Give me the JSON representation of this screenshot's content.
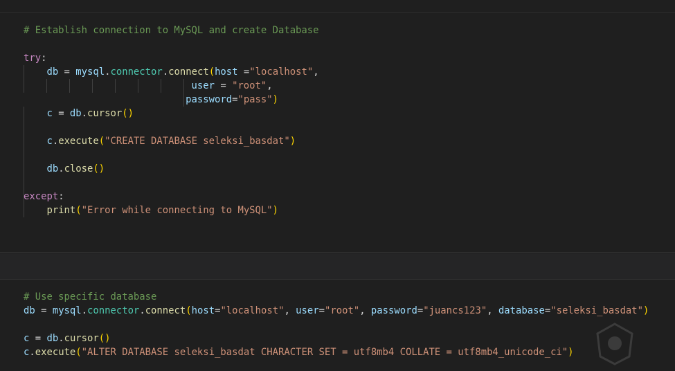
{
  "cell1": {
    "lines": [
      {
        "tokens": [
          {
            "t": "# Establish connection to MySQL and create Database",
            "c": "cm"
          }
        ]
      },
      {
        "tokens": []
      },
      {
        "tokens": [
          {
            "t": "try",
            "c": "kw"
          },
          {
            "t": ":",
            "c": "pn"
          }
        ]
      },
      {
        "tokens": [
          {
            "t": "    ",
            "c": "pn"
          },
          {
            "t": "db",
            "c": "vr"
          },
          {
            "t": " = ",
            "c": "op"
          },
          {
            "t": "mysql",
            "c": "vr"
          },
          {
            "t": ".",
            "c": "pn"
          },
          {
            "t": "connector",
            "c": "md"
          },
          {
            "t": ".",
            "c": "pn"
          },
          {
            "t": "connect",
            "c": "fn"
          },
          {
            "t": "(",
            "c": "br1"
          },
          {
            "t": "host",
            "c": "vr"
          },
          {
            "t": " =",
            "c": "op"
          },
          {
            "t": "\"localhost\"",
            "c": "st"
          },
          {
            "t": ",",
            "c": "pn"
          }
        ]
      },
      {
        "tokens": [
          {
            "t": "                             ",
            "c": "pn"
          },
          {
            "t": "user",
            "c": "vr"
          },
          {
            "t": " = ",
            "c": "op"
          },
          {
            "t": "\"root\"",
            "c": "st"
          },
          {
            "t": ",",
            "c": "pn"
          }
        ]
      },
      {
        "tokens": [
          {
            "t": "                            ",
            "c": "pn"
          },
          {
            "t": "password",
            "c": "vr"
          },
          {
            "t": "=",
            "c": "op"
          },
          {
            "t": "\"pass\"",
            "c": "st"
          },
          {
            "t": ")",
            "c": "br1"
          }
        ]
      },
      {
        "tokens": [
          {
            "t": "    ",
            "c": "pn"
          },
          {
            "t": "c",
            "c": "vr"
          },
          {
            "t": " = ",
            "c": "op"
          },
          {
            "t": "db",
            "c": "vr"
          },
          {
            "t": ".",
            "c": "pn"
          },
          {
            "t": "cursor",
            "c": "fn"
          },
          {
            "t": "()",
            "c": "br1"
          }
        ]
      },
      {
        "tokens": []
      },
      {
        "tokens": [
          {
            "t": "    ",
            "c": "pn"
          },
          {
            "t": "c",
            "c": "vr"
          },
          {
            "t": ".",
            "c": "pn"
          },
          {
            "t": "execute",
            "c": "fn"
          },
          {
            "t": "(",
            "c": "br1"
          },
          {
            "t": "\"CREATE DATABASE seleksi_basdat\"",
            "c": "st"
          },
          {
            "t": ")",
            "c": "br1"
          }
        ]
      },
      {
        "tokens": []
      },
      {
        "tokens": [
          {
            "t": "    ",
            "c": "pn"
          },
          {
            "t": "db",
            "c": "vr"
          },
          {
            "t": ".",
            "c": "pn"
          },
          {
            "t": "close",
            "c": "fn"
          },
          {
            "t": "()",
            "c": "br1"
          }
        ]
      },
      {
        "tokens": []
      },
      {
        "tokens": [
          {
            "t": "except",
            "c": "kw"
          },
          {
            "t": ":",
            "c": "pn"
          }
        ]
      },
      {
        "tokens": [
          {
            "t": "    ",
            "c": "pn"
          },
          {
            "t": "print",
            "c": "fn"
          },
          {
            "t": "(",
            "c": "br1"
          },
          {
            "t": "\"Error while connecting to MySQL\"",
            "c": "st"
          },
          {
            "t": ")",
            "c": "br1"
          }
        ]
      }
    ]
  },
  "cell2": {
    "lines": [
      {
        "tokens": [
          {
            "t": "# Use specific database",
            "c": "cm"
          }
        ]
      },
      {
        "tokens": [
          {
            "t": "db",
            "c": "vr"
          },
          {
            "t": " = ",
            "c": "op"
          },
          {
            "t": "mysql",
            "c": "vr"
          },
          {
            "t": ".",
            "c": "pn"
          },
          {
            "t": "connector",
            "c": "md"
          },
          {
            "t": ".",
            "c": "pn"
          },
          {
            "t": "connect",
            "c": "fn"
          },
          {
            "t": "(",
            "c": "br1"
          },
          {
            "t": "host",
            "c": "vr"
          },
          {
            "t": "=",
            "c": "op"
          },
          {
            "t": "\"localhost\"",
            "c": "st"
          },
          {
            "t": ", ",
            "c": "pn"
          },
          {
            "t": "user",
            "c": "vr"
          },
          {
            "t": "=",
            "c": "op"
          },
          {
            "t": "\"root\"",
            "c": "st"
          },
          {
            "t": ", ",
            "c": "pn"
          },
          {
            "t": "password",
            "c": "vr"
          },
          {
            "t": "=",
            "c": "op"
          },
          {
            "t": "\"juancs123\"",
            "c": "st"
          },
          {
            "t": ", ",
            "c": "pn"
          },
          {
            "t": "database",
            "c": "vr"
          },
          {
            "t": "=",
            "c": "op"
          },
          {
            "t": "\"seleksi_basdat\"",
            "c": "st"
          },
          {
            "t": ")",
            "c": "br1"
          }
        ]
      },
      {
        "tokens": []
      },
      {
        "tokens": [
          {
            "t": "c",
            "c": "vr"
          },
          {
            "t": " = ",
            "c": "op"
          },
          {
            "t": "db",
            "c": "vr"
          },
          {
            "t": ".",
            "c": "pn"
          },
          {
            "t": "cursor",
            "c": "fn"
          },
          {
            "t": "()",
            "c": "br1"
          }
        ]
      },
      {
        "tokens": [
          {
            "t": "c",
            "c": "vr"
          },
          {
            "t": ".",
            "c": "pn"
          },
          {
            "t": "execute",
            "c": "fn"
          },
          {
            "t": "(",
            "c": "br1"
          },
          {
            "t": "\"ALTER DATABASE seleksi_basdat CHARACTER SET = utf8mb4 COLLATE = utf8mb4_unicode_ci\"",
            "c": "st"
          },
          {
            "t": ")",
            "c": "br1"
          }
        ]
      }
    ]
  }
}
